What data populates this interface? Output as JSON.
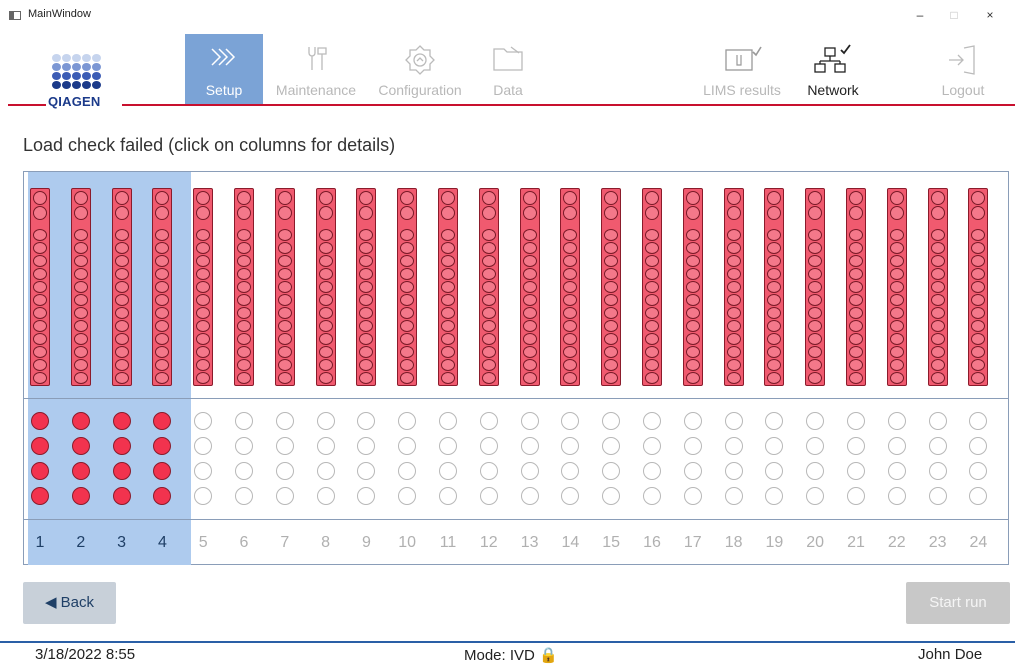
{
  "window": {
    "title": "MainWindow",
    "minimize": "–",
    "maximize": "□",
    "close": "×"
  },
  "logo": {
    "text": "QIAGEN"
  },
  "nav": {
    "setup": "Setup",
    "maintenance": "Maintenance",
    "configuration": "Configuration",
    "data": "Data",
    "lims": "LIMS results",
    "network": "Network",
    "logout": "Logout"
  },
  "heading": "Load check failed (click on columns for details)",
  "rack": {
    "columns": [
      "1",
      "2",
      "3",
      "4",
      "5",
      "6",
      "7",
      "8",
      "9",
      "10",
      "11",
      "12",
      "13",
      "14",
      "15",
      "16",
      "17",
      "18",
      "19",
      "20",
      "21",
      "22",
      "23",
      "24"
    ],
    "selected_columns": [
      1,
      2,
      3,
      4
    ],
    "loaded_tube_columns": [
      1,
      2,
      3,
      4
    ],
    "tubes_per_column": 4,
    "failed_strip_color": "#f05a6f",
    "selected_color": "#aecbee"
  },
  "buttons": {
    "back": "◀ Back",
    "start": "Start run"
  },
  "footer": {
    "datetime": "3/18/2022 8:55",
    "mode": "Mode: IVD 🔒",
    "user": "John Doe"
  }
}
